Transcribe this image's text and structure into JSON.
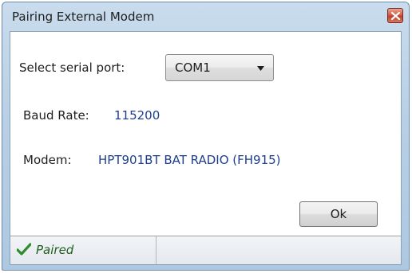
{
  "window": {
    "title": "Pairing External Modem",
    "close_icon": "close-icon"
  },
  "serial_port": {
    "label": "Select serial port:",
    "selected": "COM1"
  },
  "baud_rate": {
    "label": "Baud Rate:",
    "value": "115200"
  },
  "modem": {
    "label": "Modem:",
    "value": "HPT901BT BAT RADIO (FH915)"
  },
  "ok_button": {
    "label": "Ok"
  },
  "status": {
    "text": "Paired",
    "icon": "checkmark-icon"
  },
  "colors": {
    "value_text": "#1f3f8c",
    "status_text": "#1f5f1f",
    "check_green": "#2e8b2e",
    "close_red": "#c0402b"
  }
}
